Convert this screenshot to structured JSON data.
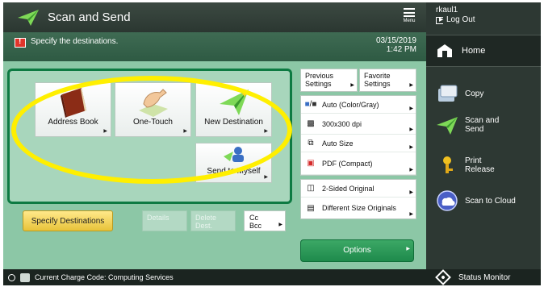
{
  "app": {
    "title": "Scan and Send",
    "menu_label": "Menu"
  },
  "user": {
    "name": "rkaul1",
    "logout_label": "Log Out"
  },
  "message": {
    "text": "Specify the destinations.",
    "date": "03/15/2019",
    "time": "1:42 PM"
  },
  "destination_tiles": [
    {
      "label": "Address Book",
      "icon": "address-book-icon"
    },
    {
      "label": "One-Touch",
      "icon": "one-touch-icon"
    },
    {
      "label": "New Destination",
      "icon": "new-destination-icon"
    },
    {
      "label": "Send to Myself",
      "icon": "send-to-myself-icon"
    }
  ],
  "actions": {
    "specify": "Specify Destinations",
    "details": "Details",
    "delete": "Delete Dest.",
    "cc": "Cc",
    "bcc": "Bcc"
  },
  "settings": {
    "previous": "Previous Settings",
    "favorite": "Favorite Settings",
    "color": "Auto (Color/Gray)",
    "resolution": "300x300 dpi",
    "size": "Auto Size",
    "format": "PDF (Compact)",
    "sided": "2-Sided Original",
    "diff_size": "Different Size Originals",
    "options": "Options"
  },
  "sidebar": {
    "home": "Home",
    "items": [
      {
        "label": "Copy",
        "icon": "copy-icon"
      },
      {
        "label": "Scan and Send",
        "icon": "scan-send-icon"
      },
      {
        "label": "Print Release",
        "icon": "print-release-icon"
      },
      {
        "label": "Scan to Cloud",
        "icon": "scan-cloud-icon"
      }
    ],
    "status_monitor": "Status Monitor"
  },
  "footer": {
    "charge_code": "Current Charge Code: Computing Services"
  },
  "colors": {
    "accent_green": "#0d7a42",
    "highlight_yellow": "#ffef00",
    "specify_yellow": "#e8c33a"
  }
}
